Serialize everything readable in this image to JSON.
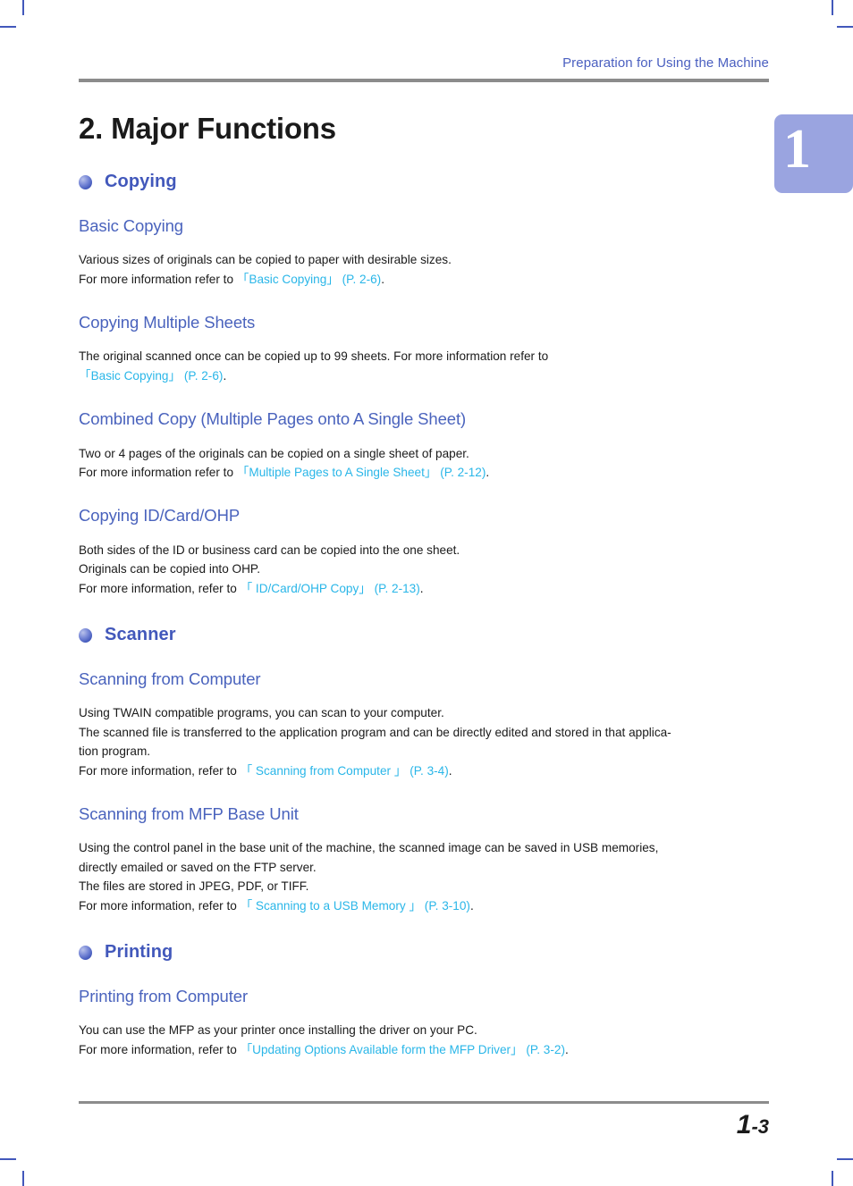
{
  "header": {
    "running_title": "Preparation for Using the Machine"
  },
  "thumb_tab": {
    "chapter_number": "1"
  },
  "title": {
    "number": "2.",
    "text": "Major Functions",
    "full": "2. Major Functions"
  },
  "sections": [
    {
      "title": "Copying",
      "subsections": [
        {
          "heading": "Basic Copying",
          "lines": [
            {
              "parts": [
                {
                  "t": "Various sizes of originals can be copied to paper with desirable sizes.",
                  "link": false
                }
              ]
            },
            {
              "parts": [
                {
                  "t": "For more information refer to ",
                  "link": false
                },
                {
                  "t": "「Basic Copying」 (P. 2-6)",
                  "link": true
                },
                {
                  "t": ".",
                  "link": false
                }
              ]
            }
          ]
        },
        {
          "heading": "Copying Multiple Sheets",
          "lines": [
            {
              "parts": [
                {
                  "t": "The original scanned once can be copied up to 99 sheets.  For more information refer to",
                  "link": false
                }
              ]
            },
            {
              "parts": [
                {
                  "t": "「Basic Copying」 (P. 2-6)",
                  "link": true
                },
                {
                  "t": ".",
                  "link": false
                }
              ]
            }
          ]
        },
        {
          "heading": "Combined Copy (Multiple Pages onto A Single Sheet)",
          "lines": [
            {
              "parts": [
                {
                  "t": "Two or 4 pages of the originals can be copied on a single sheet of paper.",
                  "link": false
                }
              ]
            },
            {
              "parts": [
                {
                  "t": "For more information refer to ",
                  "link": false
                },
                {
                  "t": "「Multiple Pages to A Single Sheet」 (P. 2-12)",
                  "link": true
                },
                {
                  "t": ".",
                  "link": false
                }
              ]
            }
          ]
        },
        {
          "heading": "Copying ID/Card/OHP",
          "lines": [
            {
              "parts": [
                {
                  "t": "Both sides of the ID or business card can be copied into the one sheet.",
                  "link": false
                }
              ]
            },
            {
              "parts": [
                {
                  "t": "Originals can be copied into OHP.",
                  "link": false
                }
              ]
            },
            {
              "parts": [
                {
                  "t": "For more information, refer to ",
                  "link": false
                },
                {
                  "t": "「 ID/Card/OHP Copy」 (P. 2-13)",
                  "link": true
                },
                {
                  "t": ".",
                  "link": false
                }
              ]
            }
          ]
        }
      ]
    },
    {
      "title": "Scanner",
      "subsections": [
        {
          "heading": "Scanning from Computer",
          "lines": [
            {
              "parts": [
                {
                  "t": "Using TWAIN compatible programs, you can scan to your computer.",
                  "link": false
                }
              ]
            },
            {
              "parts": [
                {
                  "t": "The scanned file is transferred to the application program and can be directly edited and stored in that applica-",
                  "link": false
                }
              ]
            },
            {
              "parts": [
                {
                  "t": "tion program.",
                  "link": false
                }
              ]
            },
            {
              "parts": [
                {
                  "t": "For more information, refer to ",
                  "link": false
                },
                {
                  "t": "「 Scanning from Computer 」 (P. 3-4)",
                  "link": true
                },
                {
                  "t": ".",
                  "link": false
                }
              ]
            }
          ]
        },
        {
          "heading": "Scanning from MFP Base Unit",
          "lines": [
            {
              "parts": [
                {
                  "t": "Using the control panel in the base unit of the machine, the scanned image can be saved in  USB memories,",
                  "link": false
                }
              ]
            },
            {
              "parts": [
                {
                  "t": "directly emailed or saved on the FTP server.",
                  "link": false
                }
              ]
            },
            {
              "parts": [
                {
                  "t": "The files are stored in JPEG, PDF, or TIFF.",
                  "link": false
                }
              ]
            },
            {
              "parts": [
                {
                  "t": "For more information, refer to ",
                  "link": false
                },
                {
                  "t": "「 Scanning to a USB Memory 」 (P. 3-10)",
                  "link": true
                },
                {
                  "t": ".",
                  "link": false
                }
              ]
            }
          ]
        }
      ]
    },
    {
      "title": "Printing",
      "subsections": [
        {
          "heading": "Printing from Computer",
          "lines": [
            {
              "parts": [
                {
                  "t": "You can use the MFP as your printer once installing the driver on your PC.",
                  "link": false
                }
              ]
            },
            {
              "parts": [
                {
                  "t": "For more information, refer to ",
                  "link": false
                },
                {
                  "t": "「Updating Options Available form the MFP Driver」 (P. 3-2)",
                  "link": true
                },
                {
                  "t": ".",
                  "link": false
                }
              ]
            }
          ]
        }
      ]
    }
  ],
  "footer": {
    "page_major": "1",
    "page_minor": "-3",
    "page_number": "1-3"
  },
  "colors": {
    "heading_blue": "#4258bb",
    "subheading_blue": "#4a63bd",
    "link_cyan": "#29b6e8",
    "tab_periwinkle": "#9aa4e0",
    "rule_gray": "#8c8c8c",
    "body_text": "#1a1a1a"
  }
}
